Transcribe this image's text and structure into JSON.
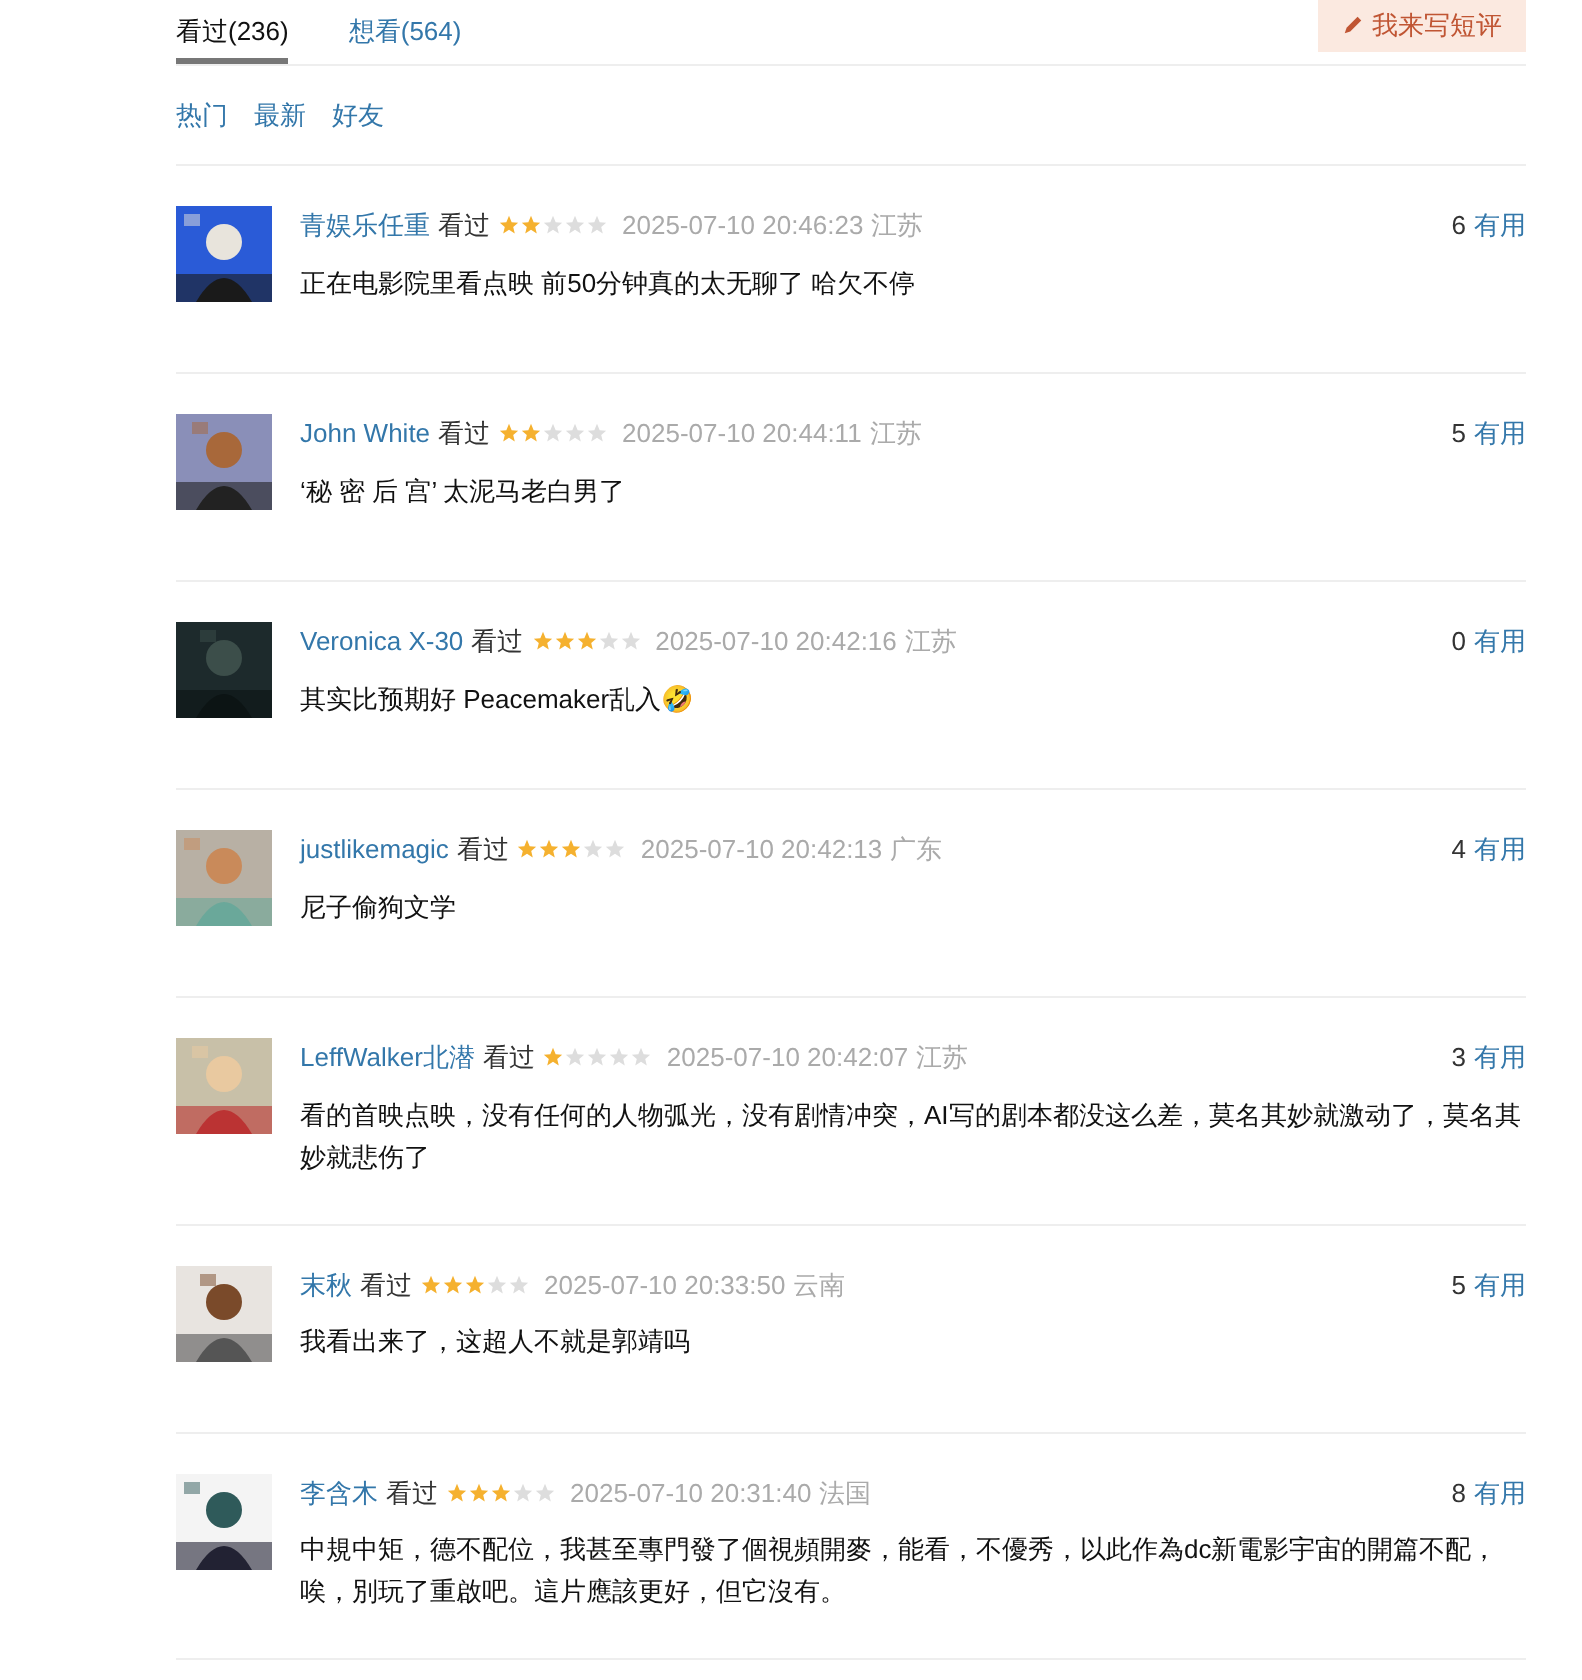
{
  "tabs": [
    {
      "label": "看过(236)",
      "selected": true
    },
    {
      "label": "想看(564)",
      "selected": false
    }
  ],
  "write_button": {
    "label": "我来写短评"
  },
  "filters": [
    "热门",
    "最新",
    "好友"
  ],
  "comments": [
    {
      "user": "青娱乐任重",
      "status": "看过",
      "stars": 2,
      "time": "2025-07-10 20:46:23",
      "location": "江苏",
      "votes": "6",
      "vote_label": "有用",
      "text": "正在电影院里看点映 前50分钟真的太无聊了 哈欠不停"
    },
    {
      "user": "John White",
      "status": "看过",
      "stars": 2,
      "time": "2025-07-10 20:44:11",
      "location": "江苏",
      "votes": "5",
      "vote_label": "有用",
      "text": "‘秘 密 后 宫’ 太泥马老白男了"
    },
    {
      "user": "Veronica X-30",
      "status": "看过",
      "stars": 3,
      "time": "2025-07-10 20:42:16",
      "location": "江苏",
      "votes": "0",
      "vote_label": "有用",
      "text": "其实比预期好 Peacemaker乱入🤣"
    },
    {
      "user": "justlikemagic",
      "status": "看过",
      "stars": 3,
      "time": "2025-07-10 20:42:13",
      "location": "广东",
      "votes": "4",
      "vote_label": "有用",
      "text": "尼子偷狗文学"
    },
    {
      "user": "LeffWalker北潜",
      "status": "看过",
      "stars": 1,
      "time": "2025-07-10 20:42:07",
      "location": "江苏",
      "votes": "3",
      "vote_label": "有用",
      "text": "看的首映点映，没有任何的人物弧光，没有剧情冲突，AI写的剧本都没这么差，莫名其妙就激动了，莫名其妙就悲伤了"
    },
    {
      "user": "末秋",
      "status": "看过",
      "stars": 3,
      "time": "2025-07-10 20:33:50",
      "location": "云南",
      "votes": "5",
      "vote_label": "有用",
      "text": "我看出来了，这超人不就是郭靖吗"
    },
    {
      "user": "李含木",
      "status": "看过",
      "stars": 3,
      "time": "2025-07-10 20:31:40",
      "location": "法国",
      "votes": "8",
      "vote_label": "有用",
      "text": "中規中矩，德不配位，我甚至專門發了個視頻開麥，能看，不優秀，以此作為dc新電影宇宙的開篇不配，唉，別玩了重啟吧。這片應該更好，但它沒有。"
    }
  ]
}
